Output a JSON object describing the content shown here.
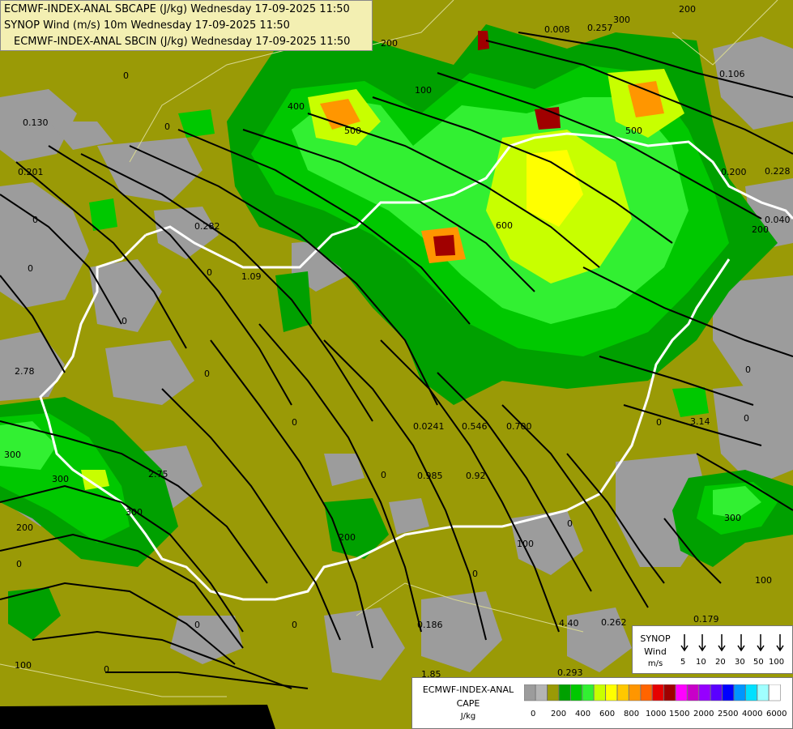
{
  "titles": {
    "line1": "ECMWF-INDEX-ANAL SBCAPE (J/kg) Wednesday 17-09-2025 11:50",
    "line2": "SYNOP Wind (m/s) 10m Wednesday 17-09-2025 11:50",
    "line3": "ECMWF-INDEX-ANAL SBCIN (J/kg) Wednesday 17-09-2025 11:50"
  },
  "wind_legend": {
    "line1": "SYNOP",
    "line2": "Wind",
    "line3": "m/s",
    "values": [
      "5",
      "10",
      "20",
      "30",
      "50",
      "100"
    ]
  },
  "cape_legend": {
    "line1": "ECMWF-INDEX-ANAL",
    "line2": "CAPE",
    "line3": "J/kg",
    "ticks": [
      "0",
      "200",
      "400",
      "600",
      "800",
      "1000",
      "1500",
      "2000",
      "2500",
      "4000",
      "6000"
    ],
    "colors": [
      "#9c9c9c",
      "#b4b4b4",
      "#9a9a06",
      "#00a000",
      "#00c800",
      "#32f032",
      "#c8ff00",
      "#ffff00",
      "#ffc800",
      "#ff9600",
      "#ff6400",
      "#e60000",
      "#a00000",
      "#ff00ff",
      "#c800c8",
      "#9600ff",
      "#5a00ff",
      "#0000ff",
      "#0096ff",
      "#00e0ff",
      "#a0ffff",
      "#ffffff"
    ]
  },
  "map_colors": {
    "background": "#9a9a06",
    "cin_gray": "#9c9c9c",
    "green_dark": "#00a000",
    "green": "#00c800",
    "green_light": "#32f032",
    "lime": "#c8ff00",
    "yellow": "#ffff00",
    "orange": "#ff9600",
    "red": "#e60000",
    "darkred": "#a00000",
    "border": "#ffffff",
    "night": "#000000"
  },
  "map_labels": {
    "l_0_130": "0.130",
    "l_0_201": "0.201",
    "l_2_78": "2.78",
    "l_2_75": "2.75",
    "l_0_282": "0.282",
    "l_1_09": "1.09",
    "l_0_008": "0.008",
    "l_0_257": "0.257",
    "l_0_106": "0.106",
    "l_0_228": "0.228",
    "l_0_200": "0.200",
    "l_0_040": "0.040",
    "l_0_0241": "0.0241",
    "l_0_546": "0.546",
    "l_0_700": "0.700",
    "l_0_985": "0.985",
    "l_0_92": "0.92",
    "l_3_14": "3.14",
    "l_0_186": "0.186",
    "l_1_85": "1.85",
    "l_0_293": "0.293",
    "l_4_40": "4.40",
    "l_0_262": "0.262",
    "l_0_179": "0.179",
    "c_100": "100",
    "c_200": "200",
    "c_300": "300",
    "c_400": "400",
    "c_500": "500",
    "c_600": "600",
    "zero": "0"
  }
}
